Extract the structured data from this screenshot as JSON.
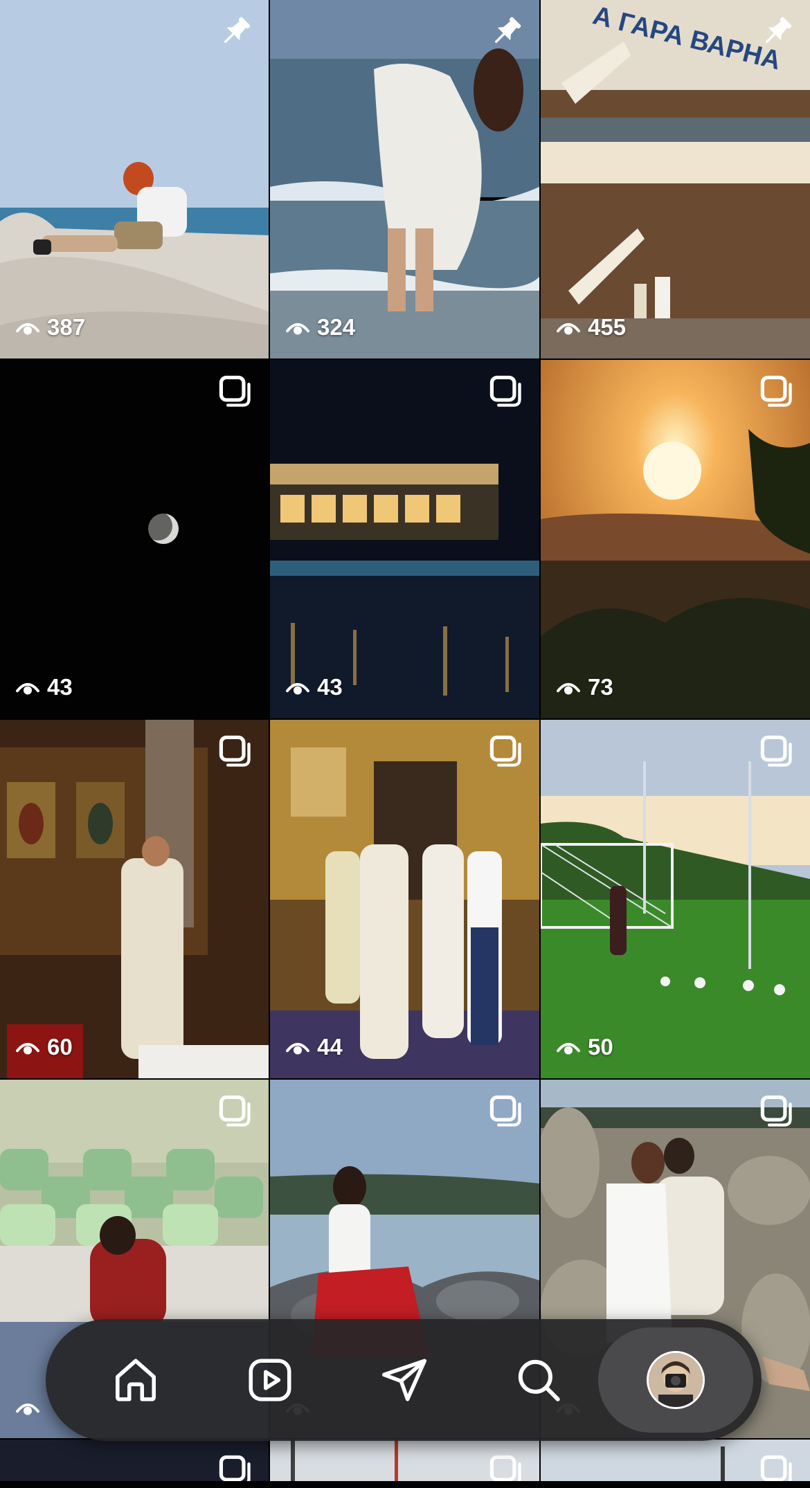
{
  "grid": {
    "tiles": [
      {
        "badge": "pin-icon",
        "views": "387"
      },
      {
        "badge": "pin-icon",
        "views": "324"
      },
      {
        "badge": "pin-icon",
        "views": "455"
      },
      {
        "badge": "carousel-icon",
        "views": "43"
      },
      {
        "badge": "carousel-icon",
        "views": "43"
      },
      {
        "badge": "carousel-icon",
        "views": "73"
      },
      {
        "badge": "carousel-icon",
        "views": "60"
      },
      {
        "badge": "carousel-icon",
        "views": "44"
      },
      {
        "badge": "carousel-icon",
        "views": "50"
      },
      {
        "badge": "carousel-icon",
        "views": ""
      },
      {
        "badge": "carousel-icon",
        "views": ""
      },
      {
        "badge": "carousel-icon",
        "views": ""
      },
      {
        "badge": "carousel-icon",
        "views": ""
      },
      {
        "badge": "carousel-icon",
        "views": ""
      },
      {
        "badge": "carousel-icon",
        "views": ""
      }
    ],
    "station_sign_text": "А ГАРА ВАРНА"
  },
  "nav": {
    "items": [
      "home-icon",
      "reels-icon",
      "messages-icon",
      "search-icon",
      "profile-avatar"
    ],
    "active": "profile-avatar",
    "colors": {
      "bar": "#262628",
      "active_pill": "#4a4a4d",
      "icon": "#ffffff"
    }
  }
}
